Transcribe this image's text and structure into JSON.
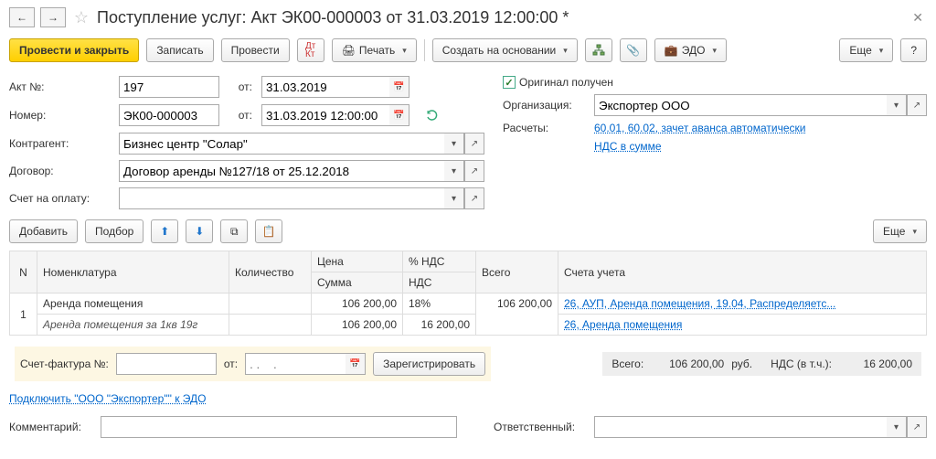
{
  "title": "Поступление услуг: Акт ЭК00-000003 от 31.03.2019 12:00:00 *",
  "toolbar": {
    "post_close": "Провести и закрыть",
    "save": "Записать",
    "post": "Провести",
    "print": "Печать",
    "create_based": "Создать на основании",
    "edo": "ЭДО",
    "more": "Еще",
    "help": "?"
  },
  "form": {
    "act_no_label": "Акт №:",
    "act_no": "197",
    "from_label": "от:",
    "act_date": "31.03.2019",
    "original_received": "Оригинал получен",
    "number_label": "Номер:",
    "number": "ЭК00-000003",
    "number_date": "31.03.2019 12:00:00",
    "org_label": "Организация:",
    "org": "Экспортер ООО",
    "counterparty_label": "Контрагент:",
    "counterparty": "Бизнес центр \"Солар\"",
    "settlements_label": "Расчеты:",
    "settlements": "60.01, 60.02, зачет аванса автоматически",
    "contract_label": "Договор:",
    "contract": "Договор аренды №127/18 от 25.12.2018",
    "nds_link": "НДС в сумме",
    "invoice_label": "Счет на оплату:",
    "invoice": ""
  },
  "rowbtns": {
    "add": "Добавить",
    "pick": "Подбор",
    "more": "Еще"
  },
  "table": {
    "h_n": "N",
    "h_nom": "Номенклатура",
    "h_qty": "Количество",
    "h_price": "Цена",
    "h_sum": "Сумма",
    "h_vatpct": "% НДС",
    "h_vat": "НДС",
    "h_total": "Всего",
    "h_accounts": "Счета учета",
    "rows": [
      {
        "n": "1",
        "nom": "Аренда помещения",
        "nom2": "Аренда помещения за 1кв 19г",
        "price": "106 200,00",
        "sum": "106 200,00",
        "vatpct": "18%",
        "vat": "16 200,00",
        "total": "106 200,00",
        "acc1": "26, АУП, Аренда помещения, 19.04, Распределяетс...",
        "acc2": "26, Аренда помещения"
      }
    ]
  },
  "sf": {
    "label": "Счет-фактура №:",
    "no": "",
    "from": "от:",
    "date_ph": ". .    .",
    "register": "Зарегистрировать"
  },
  "totals": {
    "total_lbl": "Всего:",
    "total": "106 200,00",
    "cur": "руб.",
    "vat_lbl": "НДС (в т.ч.):",
    "vat": "16 200,00"
  },
  "footer": {
    "edo_link": "Подключить \"ООО \"Экспортер\"\" к ЭДО",
    "comment_lbl": "Комментарий:",
    "comment": "",
    "responsible_lbl": "Ответственный:",
    "responsible": ""
  }
}
